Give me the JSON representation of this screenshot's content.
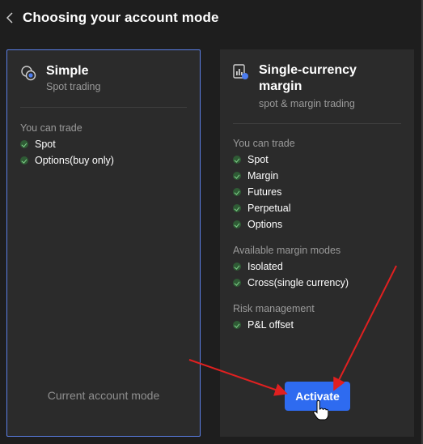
{
  "header": {
    "title": "Choosing your account mode"
  },
  "simple": {
    "title": "Simple",
    "subtitle": "Spot trading",
    "trade_label": "You can trade",
    "trade_items": [
      "Spot",
      "Options(buy only)"
    ],
    "current_label": "Current account mode"
  },
  "margin": {
    "title_line1": "Single-currency",
    "title_line2": "margin",
    "subtitle": "spot & margin trading",
    "trade_label": "You can trade",
    "trade_items": [
      "Spot",
      "Margin",
      "Futures",
      "Perpetual",
      "Options"
    ],
    "margin_modes_label": "Available margin modes",
    "margin_modes": [
      "Isolated",
      "Cross(single currency)"
    ],
    "risk_label": "Risk management",
    "risk_items": [
      "P&L offset"
    ],
    "activate_label": "Activate"
  },
  "colors": {
    "accent": "#2e6bf0",
    "selected_border": "#5b7fe6",
    "annotation_arrow": "#e02020",
    "check": "#7fd08a"
  },
  "icons": [
    "chevron-left-icon",
    "simple-mode-icon",
    "margin-mode-icon",
    "check-icon",
    "hand-cursor-icon"
  ]
}
